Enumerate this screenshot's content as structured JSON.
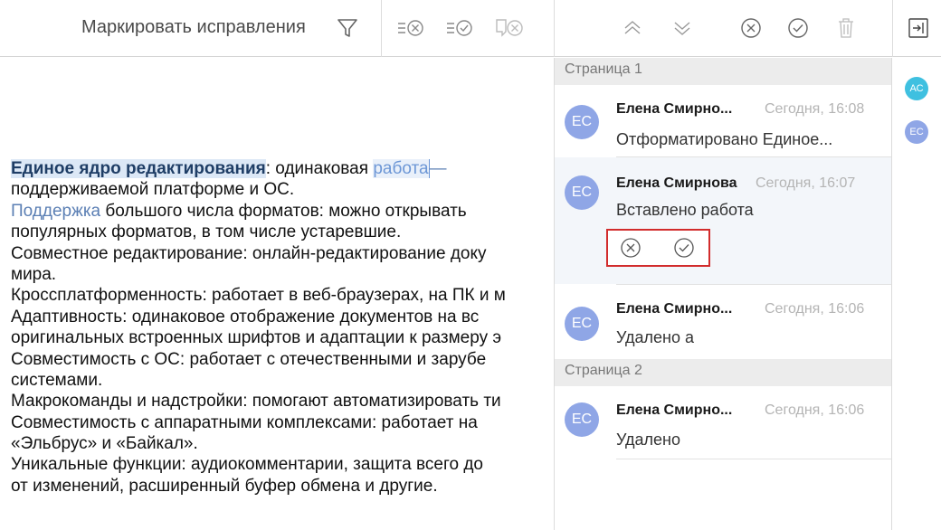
{
  "toolbar": {
    "title": "Маркировать исправления",
    "icons": [
      "filter-icon",
      "reject-all-icon",
      "accept-all-icon",
      "reject-in-comments-icon",
      "previous-change-icon",
      "next-change-icon",
      "reject-change-icon",
      "accept-change-icon",
      "delete-icon",
      "close-panel-icon"
    ]
  },
  "document": {
    "line1": {
      "bold": "Единое ядро редактирования",
      "rest": ": одинаковая ",
      "inserted": "работа",
      "tail": "— "
    },
    "line2": "поддерживаемой платформе и ОС.",
    "line3": {
      "blue": "Поддержка",
      "rest": " большого числа форматов: можно открывать"
    },
    "line4": "популярных форматов, в том числе устаревшие.",
    "line5": "Совместное редактирование: онлайн-редактирование доку",
    "line6": "мира.",
    "line7": "Кроссплатформенность: работает в веб-браузерах, на ПК и м",
    "line8": "Адаптивность: одинаковое отображение документов на вс",
    "line9": "оригинальных встроенных шрифтов и адаптации к размеру э",
    "line10": "Совместимость с ОС: работает с отечественными и зарубе",
    "line11": "системами.",
    "line12": "Макрокоманды и надстройки: помогают автоматизировать ти",
    "line13": "Совместимость с аппаратными комплексами: работает на",
    "line14": "«Эльбрус» и «Байкал».",
    "line15": "Уникальные функции: аудиокомментарии, защита всего до",
    "line16": "от изменений, расширенный буфер обмена и другие."
  },
  "panel": {
    "page1": "Страница 1",
    "page2": "Страница 2",
    "changes": [
      {
        "avatar": "ЕС",
        "author": "Елена Смирно...",
        "time": "Сегодня, 16:08",
        "text": "Отформатировано Единое..."
      },
      {
        "avatar": "ЕС",
        "author": "Елена Смирнова",
        "time": "Сегодня, 16:07",
        "text": "Вставлено  работа"
      },
      {
        "avatar": "ЕС",
        "author": "Елена Смирно...",
        "time": "Сегодня, 16:06",
        "text": "Удалено  а"
      },
      {
        "avatar": "ЕС",
        "author": "Елена Смирно...",
        "time": "Сегодня, 16:06",
        "text": "Удалено"
      }
    ]
  },
  "rail": [
    {
      "initials": "АС",
      "color": "#3fc0e0"
    },
    {
      "initials": "ЕС",
      "color": "#8fa6e6"
    }
  ],
  "colors": {
    "accent_red": "#d22c2c",
    "avatar_blue": "#8fa6e6",
    "insert_blue": "#6d97d6"
  }
}
